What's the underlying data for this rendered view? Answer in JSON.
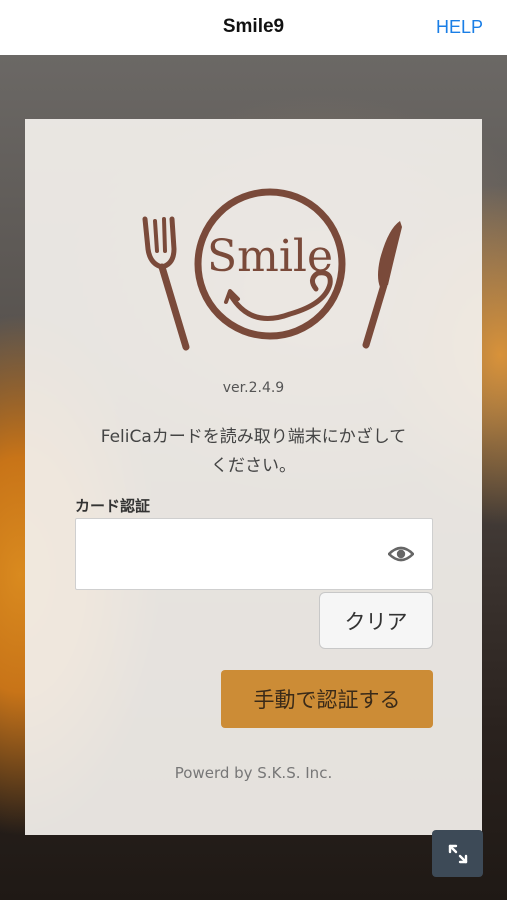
{
  "nav": {
    "title": "Smile9",
    "help": "HELP"
  },
  "logo": {
    "text": "Smile",
    "icons": [
      "fork-icon",
      "plate-icon",
      "knife-icon"
    ]
  },
  "card": {
    "version": "ver.2.4.9",
    "message_line1": "FeliCaカードを読み取り端末にかざして",
    "message_line2": "ください。",
    "field_label": "カード認証",
    "field_value": "",
    "clear_button": "クリア",
    "manual_button": "手動で認証する",
    "footer": "Powerd by S.K.S. Inc."
  },
  "colors": {
    "brand_brown": "#7a4a3a",
    "accent_button": "#cc8c36",
    "help_link": "#1a7ee6",
    "expand_button": "#3d4a57"
  },
  "icons": {
    "eye": "eye-icon",
    "expand": "expand-icon"
  }
}
